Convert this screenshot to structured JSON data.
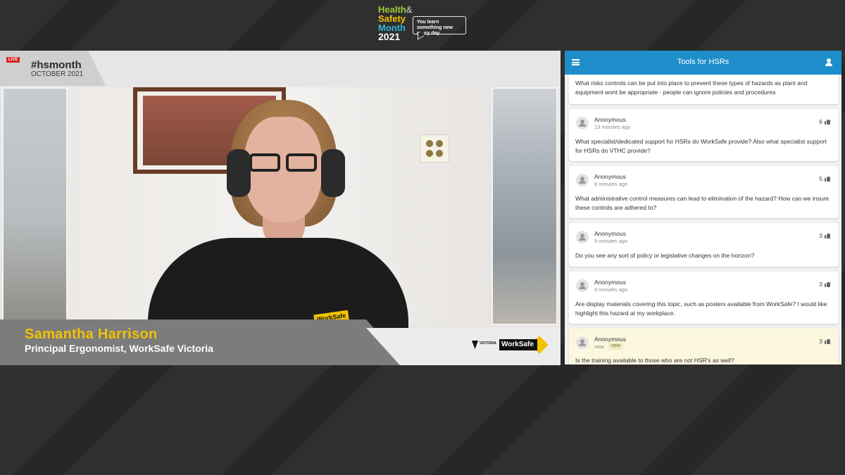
{
  "event_logo": {
    "line1": "Health",
    "amp": "&",
    "line2": "Safety",
    "line3": "Month",
    "year": "2021",
    "tagline": "You learn something new every day."
  },
  "broadcast": {
    "live_label": "LIVE",
    "hashtag": "#hsmonth",
    "month": "OCTOBER 2021",
    "speaker_name": "Samantha Harrison",
    "speaker_title": "Principal Ergonomist, WorkSafe Victoria",
    "shirt_logo": "WorkSafe",
    "vic_logo_text": "VICTORIA",
    "worksafe_logo_text": "WorkSafe"
  },
  "qa": {
    "title": "Tools for HSRs",
    "first_question": "What risks controls can be put into place to prevent these types of hazards as plant and equipment wont be appropriate - people can ignore policies and procedures",
    "questions": [
      {
        "author": "Anonymous",
        "time": "13 minutes ago",
        "likes": "6",
        "text": "What specialist/dedicated support for HSRs do WorkSafe provide? Also what specialist support for HSRs do VTHC provide?"
      },
      {
        "author": "Anonymous",
        "time": "8 minutes ago",
        "likes": "5",
        "text": "What administrative control measures can lead to elimination of the hazard? How can we insure these controls are adhered to?"
      },
      {
        "author": "Anonymous",
        "time": "9 minutes ago",
        "likes": "3",
        "text": "Do you see any sort of policy or legislative changes on the horizon?"
      },
      {
        "author": "Anonymous",
        "time": "3 minutes ago",
        "likes": "3",
        "text": "Are display materials covering this topic, such as posters available from WorkSafe? I would like highlight this hazard at my workplace."
      },
      {
        "author": "Anonymous",
        "time": "now",
        "badge": "new",
        "likes": "3",
        "text": "Is the training available to those who are not HSR's as well?"
      }
    ]
  },
  "colors": {
    "qa_header": "#1e8ecb",
    "speaker_name": "#f2c200",
    "highlight_card": "#fcf7df",
    "live": "#e02020"
  },
  "icons": [
    "menu-icon",
    "user-icon",
    "avatar-icon",
    "thumbs-up-icon"
  ]
}
